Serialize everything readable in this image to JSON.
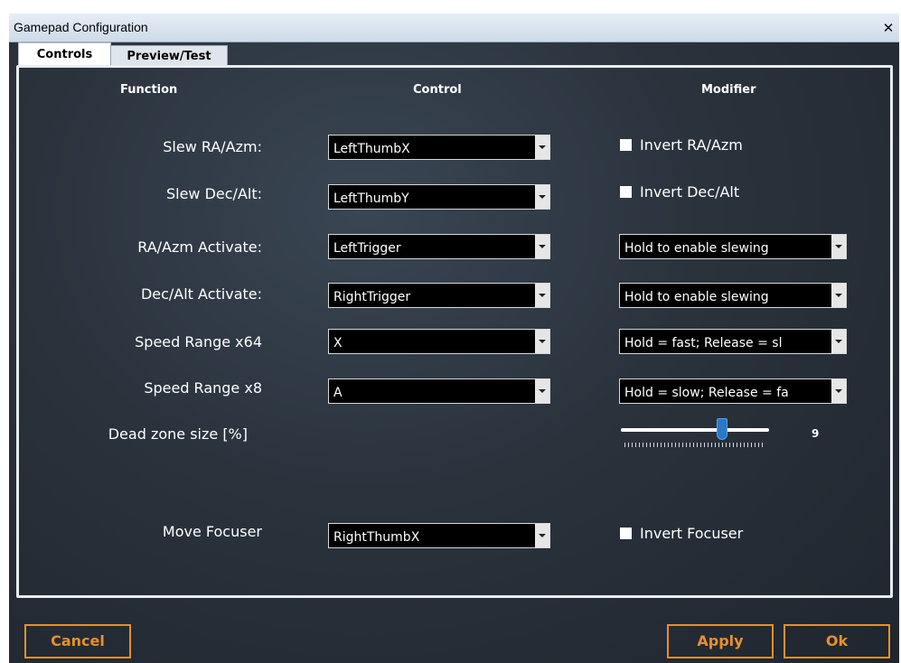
{
  "window": {
    "title": "Gamepad Configuration",
    "close_glyph": "✕"
  },
  "tabs": [
    {
      "label": "Controls",
      "selected": true
    },
    {
      "label": "Preview/Test",
      "selected": false
    }
  ],
  "headers": {
    "function": "Function",
    "control": "Control",
    "modifier": "Modifier"
  },
  "rows": [
    {
      "label": "Slew RA/Azm:",
      "control": "LeftThumbX",
      "modifier_type": "checkbox",
      "modifier": "Invert RA/Azm",
      "checked": false
    },
    {
      "label": "Slew Dec/Alt:",
      "control": "LeftThumbY",
      "modifier_type": "checkbox",
      "modifier": "Invert Dec/Alt",
      "checked": false
    },
    {
      "label": "RA/Azm Activate:",
      "control": "LeftTrigger",
      "modifier_type": "combo",
      "modifier": "Hold to enable slewing"
    },
    {
      "label": "Dec/Alt Activate:",
      "control": "RightTrigger",
      "modifier_type": "combo",
      "modifier": "Hold to enable slewing"
    },
    {
      "label": "Speed Range x64",
      "control": "X",
      "modifier_type": "combo",
      "modifier": "Hold = fast; Release = sl"
    },
    {
      "label": "Speed Range x8",
      "control": "A",
      "modifier_type": "combo",
      "modifier": "Hold = slow; Release = fa"
    }
  ],
  "dead_zone": {
    "label": "Dead zone size [%]",
    "value": "9",
    "slider_fraction": 0.7
  },
  "focuser": {
    "label": "Move Focuser",
    "control": "RightThumbX",
    "modifier": "Invert Focuser",
    "checked": false
  },
  "buttons": {
    "cancel": "Cancel",
    "apply": "Apply",
    "ok": "Ok"
  },
  "colors": {
    "accent": "#e88f2c",
    "slider_thumb": "#2a79c8",
    "combo_bg": "#000000"
  }
}
